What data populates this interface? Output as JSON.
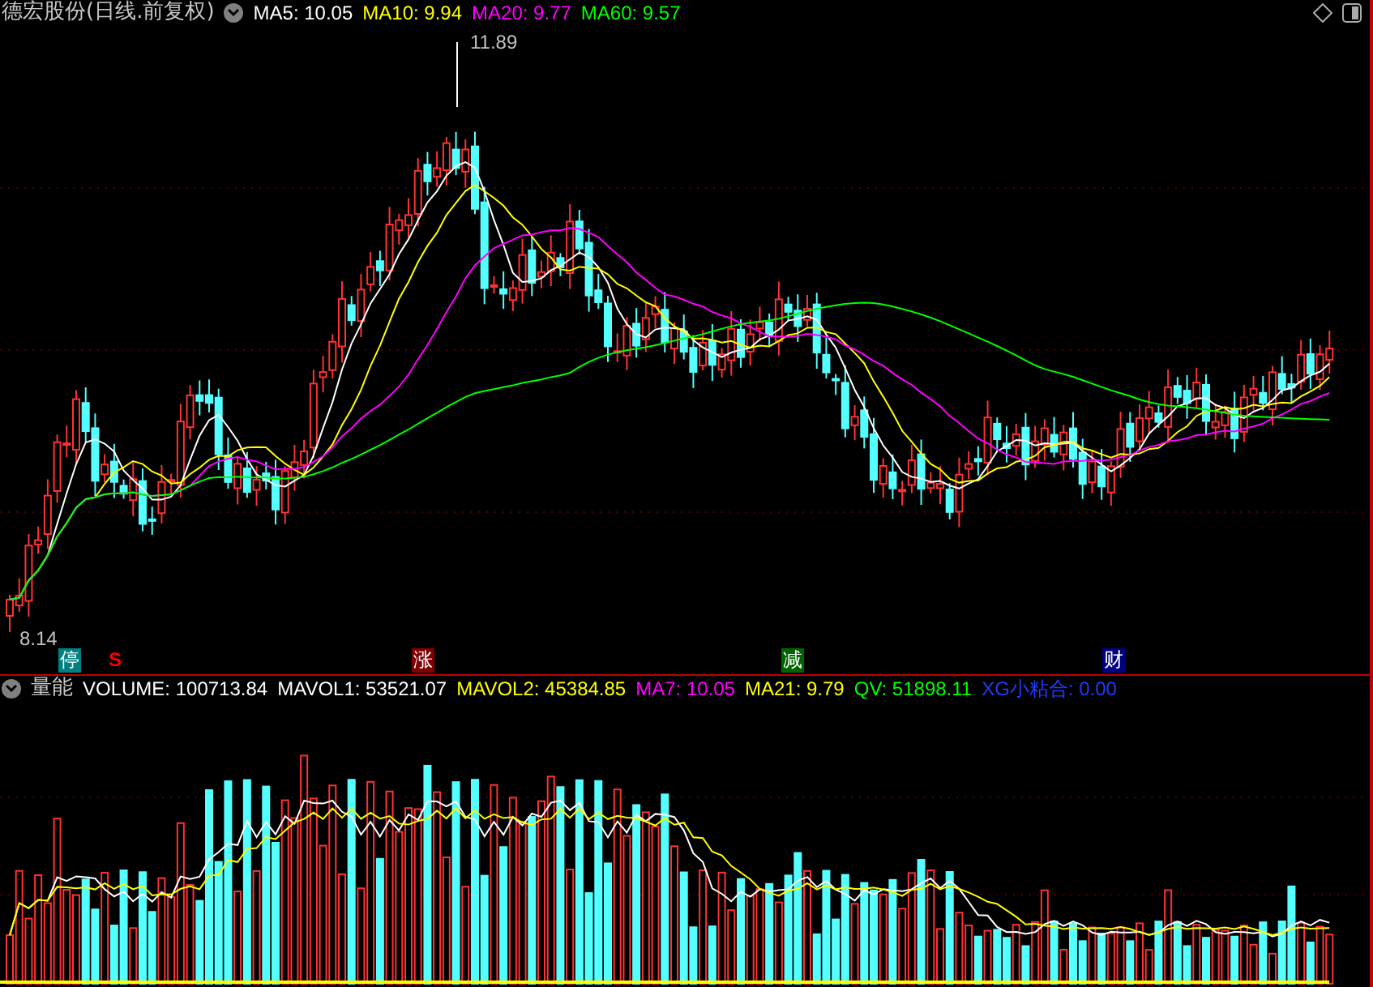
{
  "header": {
    "title": "德宏股份(日线.前复权)",
    "readings": [
      {
        "text": "MA5: 10.05",
        "color": "#ffffff"
      },
      {
        "text": "MA10: 9.94",
        "color": "#ffff00"
      },
      {
        "text": "MA20: 9.77",
        "color": "#ff00ff"
      },
      {
        "text": "MA60: 9.57",
        "color": "#00ff00"
      }
    ]
  },
  "price_chart": {
    "high_label": "11.89",
    "low_label": "8.14"
  },
  "markers": [
    {
      "text": "停",
      "kind": "badge",
      "color": "#008080"
    },
    {
      "text": "S",
      "kind": "letter",
      "color": "#ff0000"
    },
    {
      "text": "涨",
      "kind": "badge",
      "color": "#800000"
    },
    {
      "text": "减",
      "kind": "badge",
      "color": "#006400"
    },
    {
      "text": "财",
      "kind": "badge",
      "color": "#000080"
    }
  ],
  "volume_header": {
    "title": "量能",
    "readings": [
      {
        "text": "VOLUME: 100713.84",
        "color": "#ffffff"
      },
      {
        "text": "MAVOL1: 53521.07",
        "color": "#ffffff"
      },
      {
        "text": "MAVOL2: 45384.85",
        "color": "#ffff00"
      },
      {
        "text": "MA7: 10.05",
        "color": "#ff00ff"
      },
      {
        "text": "MA21: 9.79",
        "color": "#ffff00"
      },
      {
        "text": "QV: 51898.11",
        "color": "#00ff00"
      },
      {
        "text": "XG小粘合: 0.00",
        "color": "#1e3cff"
      }
    ]
  }
}
